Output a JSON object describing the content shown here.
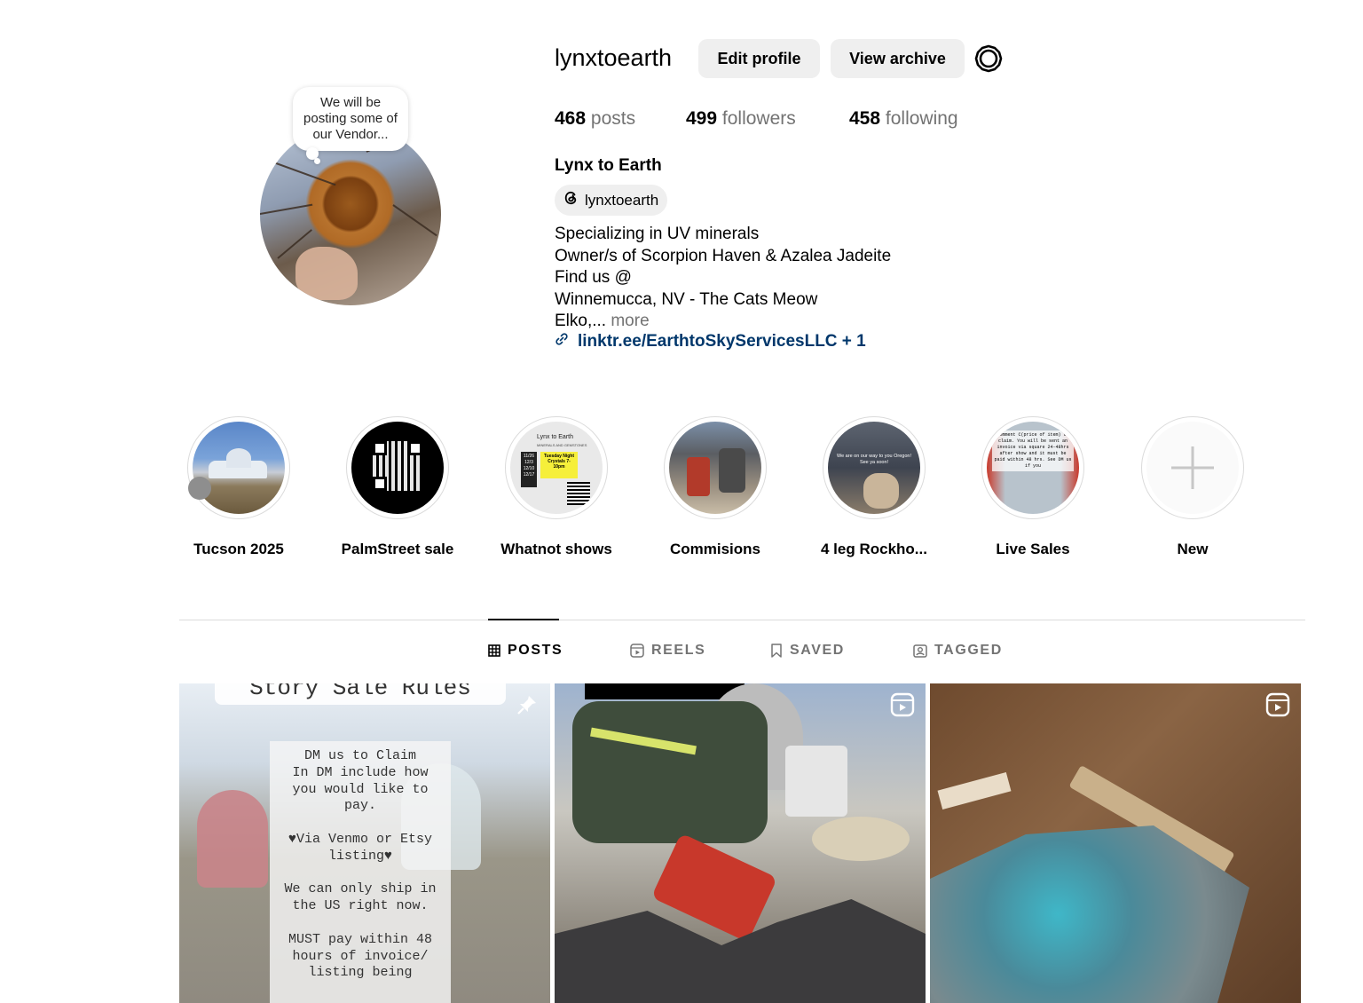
{
  "profile": {
    "note": "We will be posting some of our Vendor...",
    "username": "lynxtoearth",
    "edit_profile": "Edit profile",
    "view_archive": "View archive",
    "stats": {
      "posts_count": "468",
      "posts_label": "posts",
      "followers_count": "499",
      "followers_label": "followers",
      "following_count": "458",
      "following_label": "following"
    },
    "full_name": "Lynx to Earth",
    "threads_handle": "lynxtoearth",
    "bio_lines": [
      "Specializing in UV minerals",
      "Owner/s of Scorpion Haven & Azalea Jadeite",
      "Find us @",
      "Winnemucca, NV - The Cats Meow",
      "Elko,..."
    ],
    "more": "more",
    "link": "linktr.ee/EarthtoSkyServicesLLC + 1"
  },
  "highlights": [
    {
      "label": "Tucson 2025"
    },
    {
      "label": "PalmStreet sale"
    },
    {
      "label": "Whatnot shows"
    },
    {
      "label": "Commisions"
    },
    {
      "label": "4 leg Rockho..."
    },
    {
      "label": "Live Sales"
    },
    {
      "label": "New"
    }
  ],
  "highlight_text": {
    "whatnot_title": "Lynx to Earth",
    "whatnot_sub": "MINERALS AND GEMSTONES",
    "whatnot_dates": "11/26\n12/3\n12/10\n12/17",
    "whatnot_box": "Tuesday Night Crystals 7-10pm",
    "rockhound_text": "We are on our way to you Oregon! See ya soon!",
    "live_sales_text": "Comment C(price of item) to claim. You will be sent an invoice via square 24-48hrs after show and it must be paid within 48 hrs. See DM us if you"
  },
  "tabs": [
    {
      "label": "POSTS",
      "active": true
    },
    {
      "label": "REELS"
    },
    {
      "label": "SAVED"
    },
    {
      "label": "TAGGED"
    }
  ],
  "posts": {
    "p1_header": "Story Sale Rules",
    "p1_text": "DM us to Claim\nIn DM include how you would like to pay.\n\n♥Via Venmo or Etsy listing♥\n\nWe can only ship in the US right now.\n\nMUST pay within 48 hours of invoice/ listing being"
  },
  "colors": {
    "link": "#00376b",
    "secondary_text": "#737373",
    "button_bg": "#efefef",
    "divider": "#dbdbdb"
  }
}
